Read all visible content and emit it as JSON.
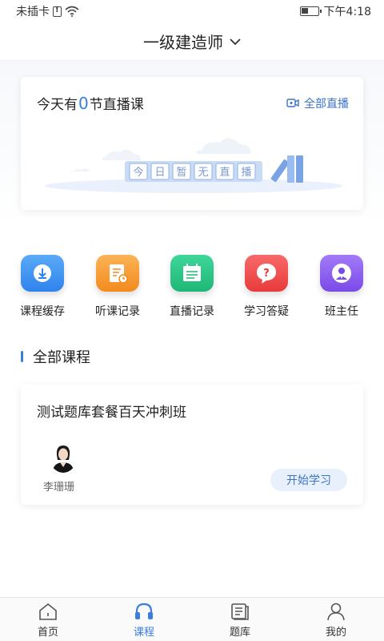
{
  "status_bar": {
    "carrier": "未插卡",
    "time": "下午4:18"
  },
  "header": {
    "title": "一级建造师"
  },
  "live": {
    "prefix": "今天有",
    "count": "0",
    "suffix": "节直播课",
    "all_live_label": "全部直播",
    "empty_chars": [
      "今",
      "日",
      "暂",
      "无",
      "直",
      "播"
    ]
  },
  "quick_actions": [
    {
      "label": "课程缓存",
      "icon": "download-icon",
      "color": "#3a8ff0"
    },
    {
      "label": "听课记录",
      "icon": "record-icon",
      "color": "#f49a2e"
    },
    {
      "label": "直播记录",
      "icon": "calendar-icon",
      "color": "#2bc287"
    },
    {
      "label": "学习答疑",
      "icon": "question-icon",
      "color": "#f04a4a"
    },
    {
      "label": "班主任",
      "icon": "teacher-icon",
      "color": "#8a5cf0"
    }
  ],
  "section": {
    "title": "全部课程"
  },
  "course": {
    "title": "测试题库套餐百天冲刺班",
    "teacher": "李珊珊",
    "button": "开始学习"
  },
  "tabs": [
    {
      "label": "首页",
      "icon": "home-icon",
      "active": false
    },
    {
      "label": "课程",
      "icon": "headphones-icon",
      "active": true
    },
    {
      "label": "题库",
      "icon": "question-bank-icon",
      "active": false
    },
    {
      "label": "我的",
      "icon": "profile-icon",
      "active": false
    }
  ],
  "colors": {
    "accent": "#3b7ddd",
    "link": "#3c73c8"
  }
}
